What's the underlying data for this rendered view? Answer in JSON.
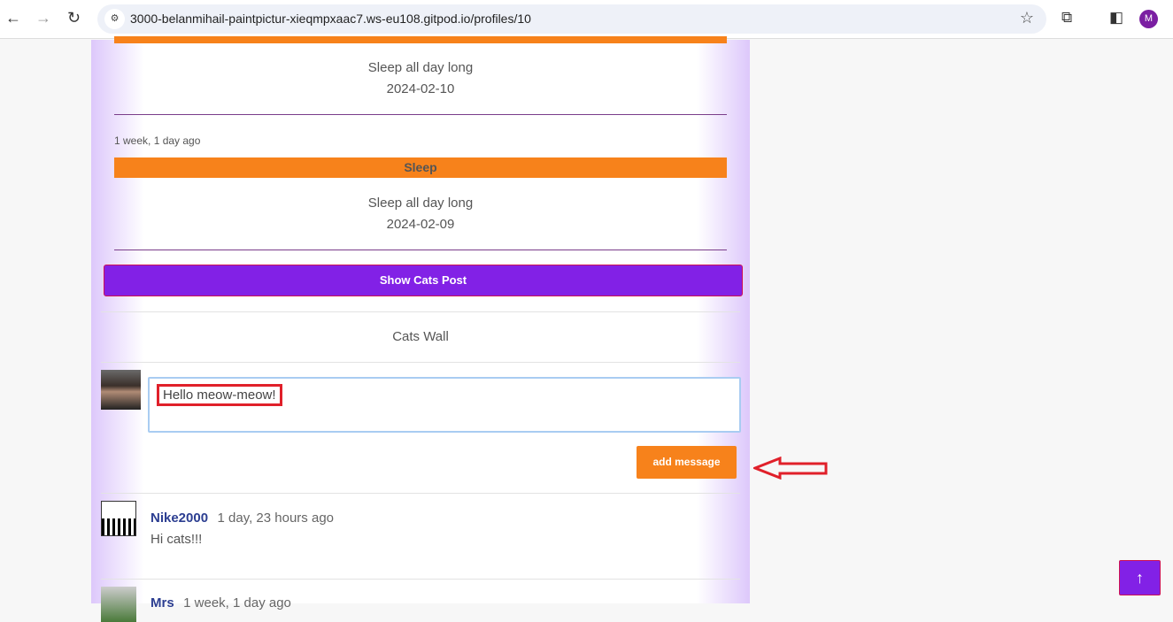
{
  "browser": {
    "url": "3000-belanmihail-paintpictur-xieqmpxaac7.ws-eu108.gitpod.io/profiles/10",
    "profile_initial": "M"
  },
  "posts": [
    {
      "text": "Sleep all day long",
      "date": "2024-02-10"
    },
    {
      "ago": "1 week, 1 day ago",
      "title": "Sleep",
      "text": "Sleep all day long",
      "date": "2024-02-09"
    }
  ],
  "show_cats_post": "Show Cats Post",
  "wall": {
    "title": "Cats Wall",
    "message_value": "Hello meow-meow!",
    "add_label": "add message"
  },
  "messages": [
    {
      "user": "Nike2000",
      "time": "1 day, 23 hours ago",
      "text": "Hi cats!!!"
    },
    {
      "user": "Mrs",
      "time": "1 week, 1 day ago"
    }
  ],
  "scroll_top_icon": "arrow-up-icon"
}
